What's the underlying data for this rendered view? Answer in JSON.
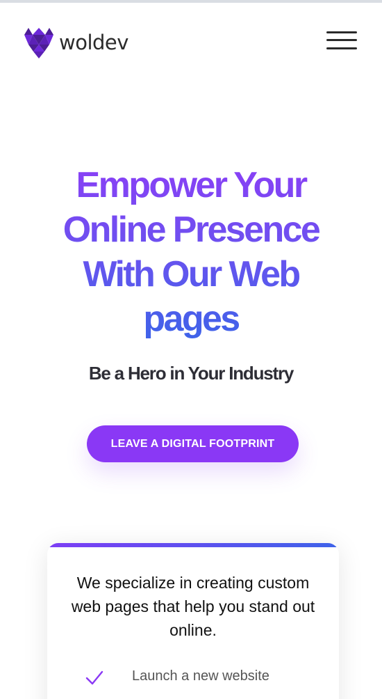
{
  "header": {
    "logo_text": "woldev",
    "logo_icon": "woldev-logo-mark",
    "menu_icon": "hamburger-menu-icon"
  },
  "hero": {
    "title": "Empower Your Online Presence With Our Web pages",
    "subtitle": "Be a Hero in Your Industry",
    "cta_label": "LEAVE A DIGITAL FOOTPRINT"
  },
  "card": {
    "text": "We specialize in creating custom web pages that help you stand out online.",
    "features": [
      {
        "label": "Launch a new website",
        "icon": "check-icon"
      }
    ]
  },
  "colors": {
    "brand_purple": "#8a38f5",
    "gradient_start": "#8a3ff6",
    "gradient_end": "#3e63e9",
    "logo_purple": "#5b21b6",
    "text_dark": "#2b2b2b"
  }
}
